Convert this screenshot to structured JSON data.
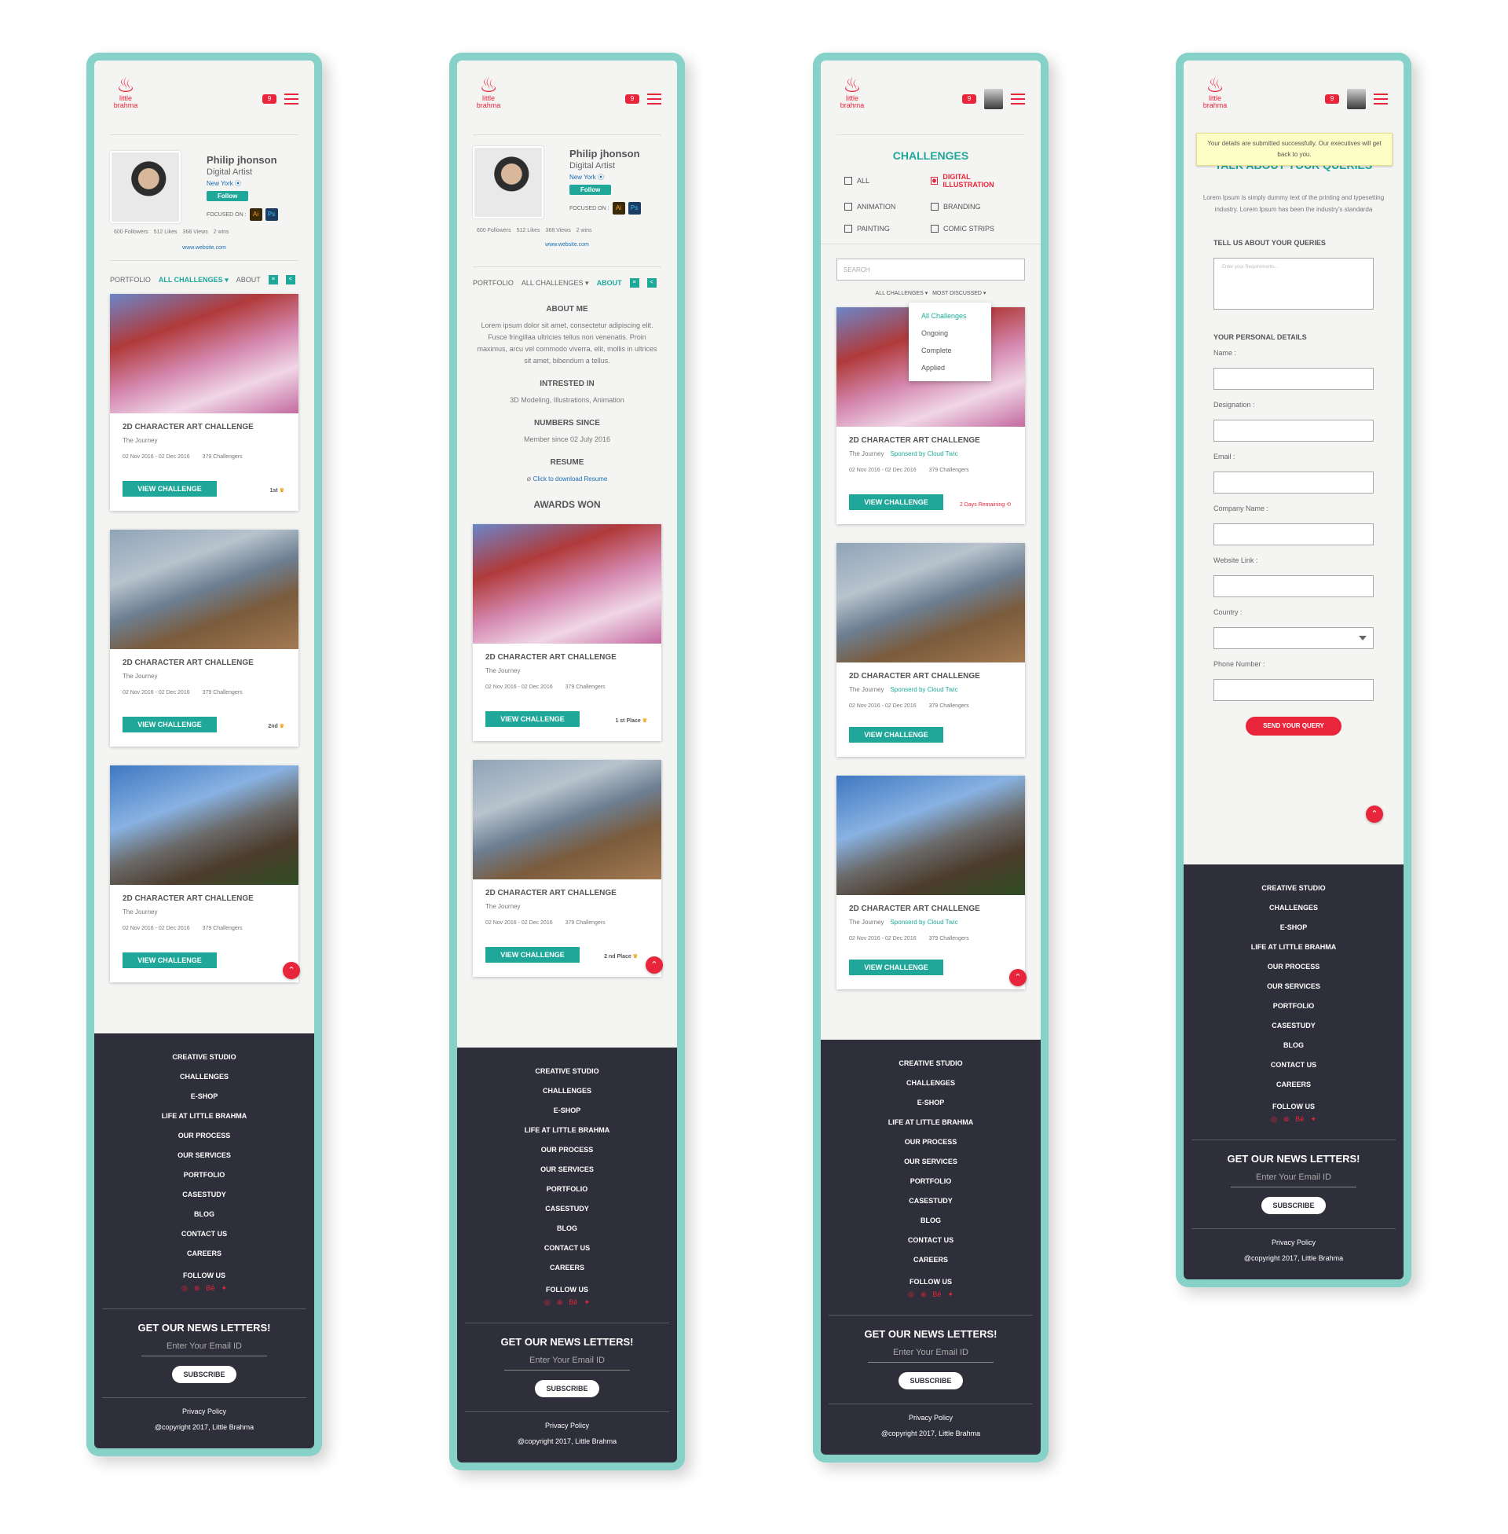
{
  "brand": {
    "logo_text": "little brahma",
    "notif_count": "9"
  },
  "profile": {
    "name": "Philip jhonson",
    "role": "Digital Artist",
    "location": "New York",
    "follow": "Follow",
    "focused_on": "FOCUSED ON :",
    "ai": "Ai",
    "ps": "Ps",
    "followers": "600 Followers",
    "likes": "512 Likes",
    "views": "368 Views",
    "wins": "2 wins",
    "website": "www.website.com"
  },
  "tabs": {
    "portfolio": "PORTFOLIO",
    "all_challenges": "ALL CHALLENGES",
    "about": "ABOUT"
  },
  "cards": [
    {
      "title": "2D CHARACTER ART CHALLENGE",
      "sub": "The Journey",
      "date": "02 Nov 2016 - 02 Dec 2016",
      "count": "379 Challengers",
      "button": "VIEW CHALLENGE",
      "rank": "1st"
    },
    {
      "title": "2D CHARACTER ART CHALLENGE",
      "sub": "The Journey",
      "date": "02 Nov 2016 - 02 Dec 2016",
      "count": "379 Challengers",
      "button": "VIEW CHALLENGE",
      "rank": "2nd"
    },
    {
      "title": "2D CHARACTER ART CHALLENGE",
      "sub": "The Journey",
      "date": "02 Nov 2016 - 02 Dec 2016",
      "count": "379 Challengers",
      "button": "VIEW CHALLENGE",
      "rank": ""
    }
  ],
  "about": {
    "about_me": "ABOUT ME",
    "about_text": "Lorem ipsum dolor sit amet, consectetur adipiscing elit. Fusce fringillaa ultricies tellus non venenatis. Proin maximus, arcu vel commodo viverra, elit, mollis in ultrices sit amet, bibendum a tellus.",
    "interested": "INTRESTED IN",
    "interests": "3D Modeling, Illustrations, Animation",
    "numbers": "NUMBERS SINCE",
    "member": "Member since 02 July 2016",
    "resume": "RESUME",
    "resume_link": "Click to download Resume",
    "awards": "AWARDS WON",
    "place1": "1 st Place",
    "place2": "2 nd Place"
  },
  "challenges": {
    "title": "CHALLENGES",
    "filters": [
      "ALL",
      "DIGITAL ILLUSTRATION",
      "ANIMATION",
      "BRANDING",
      "PAINTING",
      "COMIC STRIPS"
    ],
    "search": "SEARCH",
    "sort1": "ALL CHALLENGES",
    "sort2": "MOST DISCUSSED",
    "menu": [
      "All Challenges",
      "Ongoing",
      "Complete",
      "Applied"
    ],
    "sponsor": "Sponserd by Cloud Twic",
    "remaining": "2 Days Remaining"
  },
  "query": {
    "toast": "Your details are submitted successfully. Our executives will get back to you.",
    "title": "TALK ABOUT YOUR QUERIES",
    "desc": "Lorem Ipsum is simply dummy text of the printing and typesetting industry. Lorem Ipsum has been the industry's standarda",
    "tell": "TELL US ABOUT YOUR QUERIES",
    "placeholder": "Enter your Requirements...",
    "personal": "YOUR PERSONAL DETAILS",
    "fields": [
      "Name :",
      "Designation :",
      "Email :",
      "Company Name :",
      "Website Link :",
      "Country :",
      "Phone Number :"
    ],
    "send": "SEND YOUR QUERY"
  },
  "footer": {
    "links": [
      "CREATIVE STUDIO",
      "CHALLENGES",
      "E-SHOP",
      "LIFE AT LITTLE BRAHMA",
      "OUR PROCESS",
      "OUR SERVICES",
      "PORTFOLIO",
      "CASESTUDY",
      "BLOG",
      "CONTACT US",
      "CAREERS"
    ],
    "follow": "FOLLOW US",
    "news": "GET OUR NEWS LETTERS!",
    "email_ph": "Enter Your Email ID",
    "subscribe": "SUBSCRIBE",
    "privacy": "Privacy Policy",
    "copyright": "@copyright 2017, Little Brahma"
  },
  "colors": {
    "accent": "#1fa89a",
    "brand": "#e8253a",
    "footer": "#2e2f3a",
    "frame": "#86d1c8"
  }
}
